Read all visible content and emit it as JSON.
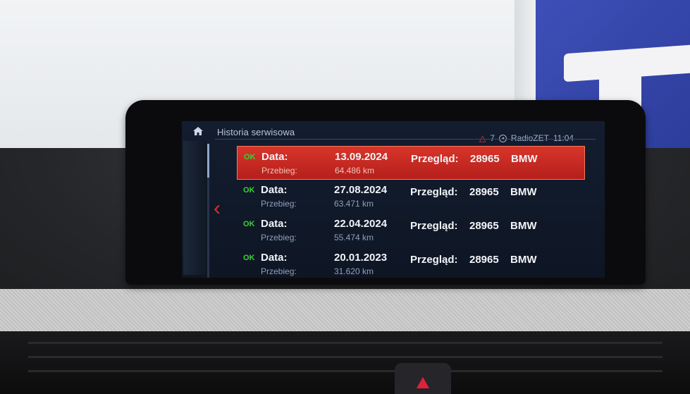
{
  "header": {
    "title": "Historia serwisowa",
    "warnings_count": "7",
    "station": "RadioZET",
    "clock": "11:04"
  },
  "icons": {
    "home": "home-icon",
    "warning": "warning-triangle-icon",
    "radio": "radio-icon",
    "back": "chevron-left-icon"
  },
  "labels": {
    "date": "Data:",
    "mileage": "Przebieg:",
    "inspection": "Przegląd:",
    "status": "OK"
  },
  "entries": [
    {
      "status": "OK",
      "date": "13.09.2024",
      "mileage": "64.486 km",
      "code": "28965",
      "brand": "BMW",
      "selected": true
    },
    {
      "status": "OK",
      "date": "27.08.2024",
      "mileage": "63.471 km",
      "code": "28965",
      "brand": "BMW",
      "selected": false
    },
    {
      "status": "OK",
      "date": "22.04.2024",
      "mileage": "55.474 km",
      "code": "28965",
      "brand": "BMW",
      "selected": false
    },
    {
      "status": "OK",
      "date": "20.01.2023",
      "mileage": "31.620 km",
      "code": "28965",
      "brand": "BMW",
      "selected": false
    }
  ],
  "colors": {
    "selection": "#c9281f",
    "ok": "#38d138",
    "warning": "#e4393e",
    "back_arrow": "#e02a2a"
  }
}
